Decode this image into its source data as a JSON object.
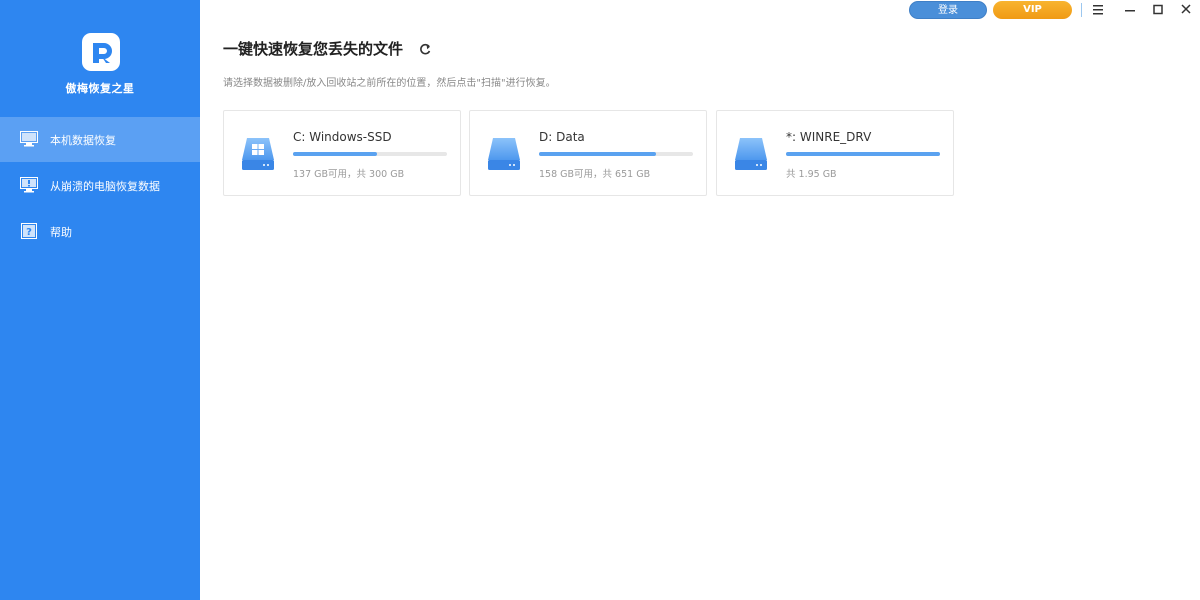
{
  "app": {
    "name": "傲梅恢复之星"
  },
  "sidebar": {
    "items": [
      {
        "label": "本机数据恢复",
        "icon": "monitor-icon",
        "active": true
      },
      {
        "label": "从崩溃的电脑恢复数据",
        "icon": "crashed-pc-icon",
        "active": false
      },
      {
        "label": "帮助",
        "icon": "help-icon",
        "active": false
      }
    ]
  },
  "titlebar": {
    "login_label": "登录",
    "vip_label": "VIP",
    "icons": [
      "menu-icon",
      "minimize-icon",
      "maximize-icon",
      "close-icon"
    ]
  },
  "main": {
    "title": "一键快速恢复您丢失的文件",
    "subtitle": "请选择数据被删除/放入回收站之前所在的位置，然后点击\"扫描\"进行恢复。",
    "drives": [
      {
        "name": "C: Windows-SSD",
        "info": "137 GB可用，共 300 GB",
        "used_fraction": 0.543,
        "windows": true
      },
      {
        "name": "D: Data",
        "info": "158 GB可用，共 651 GB",
        "used_fraction": 0.757,
        "windows": false
      },
      {
        "name": "*: WINRE_DRV",
        "info": "共 1.95 GB",
        "used_fraction": 1.0,
        "windows": false
      }
    ]
  },
  "colors": {
    "sidebar": "#2e86f0",
    "accent": "#5aa2f0",
    "vip": "#f5a623",
    "login": "#4a8fd9"
  }
}
